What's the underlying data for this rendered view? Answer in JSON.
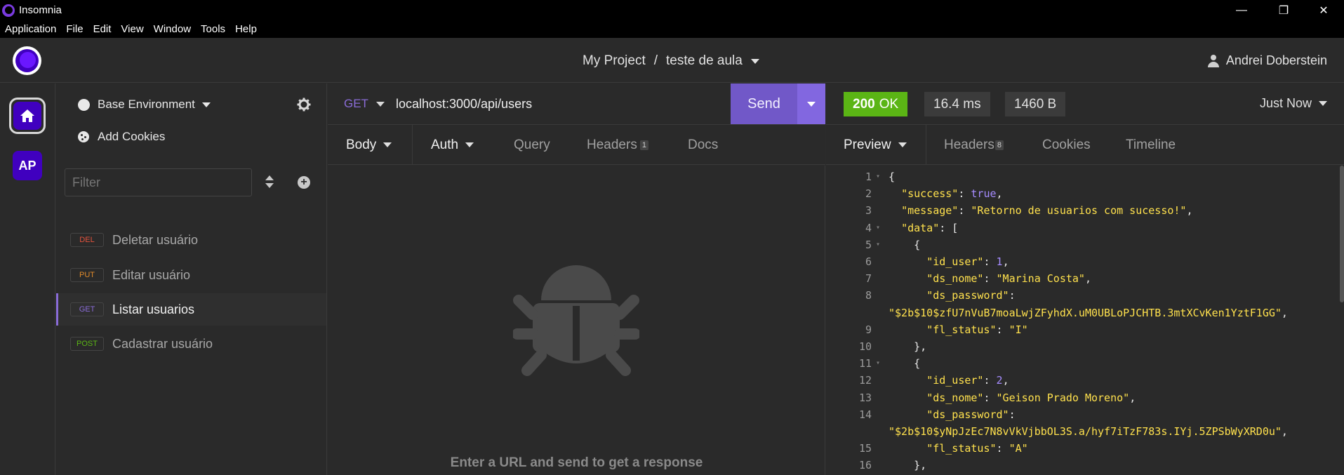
{
  "window": {
    "title": "Insomnia"
  },
  "menu": [
    "Application",
    "File",
    "Edit",
    "View",
    "Window",
    "Tools",
    "Help"
  ],
  "header": {
    "project": "My Project",
    "separator": "/",
    "collection": "teste de aula",
    "user": "Andrei Doberstein"
  },
  "rail": {
    "workspace_initials": "AP"
  },
  "sidebar": {
    "environment": "Base Environment",
    "add_cookies": "Add Cookies",
    "filter_placeholder": "Filter",
    "requests": [
      {
        "method": "DEL",
        "name": "Deletar usuário",
        "color": "#e5533d"
      },
      {
        "method": "PUT",
        "name": "Editar usuário",
        "color": "#e08a2a"
      },
      {
        "method": "GET",
        "name": "Listar usuarios",
        "color": "#8a6cd8"
      },
      {
        "method": "POST",
        "name": "Cadastrar usuário",
        "color": "#5bb515"
      }
    ]
  },
  "request": {
    "method": "GET",
    "url": "localhost:3000/api/users",
    "send_label": "Send",
    "tabs": {
      "body": "Body",
      "auth": "Auth",
      "query": "Query",
      "headers": "Headers",
      "headers_count": "1",
      "docs": "Docs"
    },
    "empty_message": "Enter a URL and send to get a response"
  },
  "response": {
    "status_code": "200",
    "status_text": "OK",
    "time": "16.4 ms",
    "size": "1460 B",
    "history": "Just Now",
    "tabs": {
      "preview": "Preview",
      "headers": "Headers",
      "headers_count": "8",
      "cookies": "Cookies",
      "timeline": "Timeline"
    },
    "lines": [
      {
        "n": "1",
        "fold": true,
        "html": "{"
      },
      {
        "n": "2",
        "fold": false,
        "html": "  <span class='k'>\"success\"</span>: <span class='b'>true</span>,"
      },
      {
        "n": "3",
        "fold": false,
        "html": "  <span class='k'>\"message\"</span>: <span class='s'>\"Retorno de usuarios com sucesso!\"</span>,"
      },
      {
        "n": "4",
        "fold": true,
        "html": "  <span class='k'>\"data\"</span>: ["
      },
      {
        "n": "5",
        "fold": true,
        "html": "    {"
      },
      {
        "n": "6",
        "fold": false,
        "html": "      <span class='k'>\"id_user\"</span>: <span class='b'>1</span>,"
      },
      {
        "n": "7",
        "fold": false,
        "html": "      <span class='k'>\"ds_nome\"</span>: <span class='s'>\"Marina Costa\"</span>,"
      },
      {
        "n": "8",
        "fold": false,
        "html": "      <span class='k'>\"ds_password\"</span>:"
      },
      {
        "n": "",
        "fold": false,
        "html": "<span class='s'>\"$2b$10$zfU7nVuB7moaLwjZFyhdX.uM0UBLoPJCHTB.3mtXCvKen1YztF1GG\"</span>,"
      },
      {
        "n": "9",
        "fold": false,
        "html": "      <span class='k'>\"fl_status\"</span>: <span class='s'>\"I\"</span>"
      },
      {
        "n": "10",
        "fold": false,
        "html": "    },"
      },
      {
        "n": "11",
        "fold": true,
        "html": "    {"
      },
      {
        "n": "12",
        "fold": false,
        "html": "      <span class='k'>\"id_user\"</span>: <span class='b'>2</span>,"
      },
      {
        "n": "13",
        "fold": false,
        "html": "      <span class='k'>\"ds_nome\"</span>: <span class='s'>\"Geison Prado Moreno\"</span>,"
      },
      {
        "n": "14",
        "fold": false,
        "html": "      <span class='k'>\"ds_password\"</span>:"
      },
      {
        "n": "",
        "fold": false,
        "html": "<span class='s'>\"$2b$10$yNpJzEc7N8vVkVjbbOL3S.a/hyf7iTzF783s.IYj.5ZPSbWyXRD0u\"</span>,"
      },
      {
        "n": "15",
        "fold": false,
        "html": "      <span class='k'>\"fl_status\"</span>: <span class='s'>\"A\"</span>"
      },
      {
        "n": "16",
        "fold": false,
        "html": "    },"
      }
    ]
  },
  "colors": {
    "accent": "#4000bf",
    "send": "#7158c8",
    "ok": "#5bb515",
    "json_key": "#ffe14d",
    "json_value": "#a68cff"
  }
}
